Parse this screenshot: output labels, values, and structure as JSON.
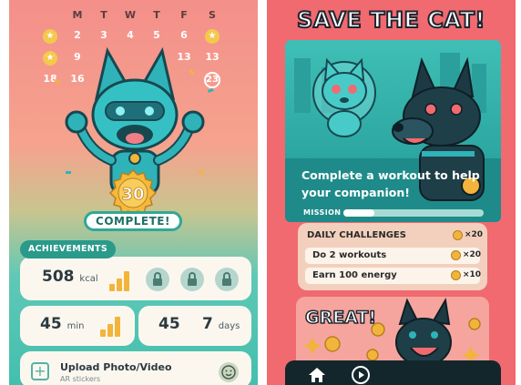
{
  "left_screen": {
    "calendar": {
      "weekdays": [
        "M",
        "T",
        "W",
        "T",
        "F",
        "S"
      ],
      "row1": [
        "2",
        "3",
        "4",
        "5",
        "6"
      ],
      "row2": [
        "9",
        "13",
        "13"
      ],
      "row3": [
        "18",
        "16",
        "23"
      ]
    },
    "badge_number": "30",
    "complete_label": "COMPLETE!",
    "achievements_label": "ACHIEVEMENTS",
    "kcal": {
      "value": "508",
      "unit": "kcal"
    },
    "minutes": {
      "value": "45",
      "unit": "min"
    },
    "days": {
      "value": "45",
      "count": "7",
      "unit": "days"
    },
    "upload": {
      "title": "Upload Photo/Video",
      "subtitle": "AR stickers"
    }
  },
  "right_screen": {
    "title": "SAVE THE CAT!",
    "mission_text": "Complete a workout to help your companion!",
    "mission_label": "MISSION",
    "mission_progress": 0.22,
    "challenges": {
      "header": "DAILY CHALLENGES",
      "header_reward": "×20",
      "items": [
        {
          "label": "Do 2 workouts",
          "reward": "×20"
        },
        {
          "label": "Earn 100 energy",
          "reward": "×10"
        }
      ]
    },
    "great_label": "GREAT!",
    "nav": {
      "home_icon": "home-icon",
      "play_icon": "play-icon"
    }
  },
  "colors": {
    "coral": "#f06a70",
    "teal": "#2fa898",
    "gold": "#f2b43a",
    "dark": "#13262c"
  }
}
